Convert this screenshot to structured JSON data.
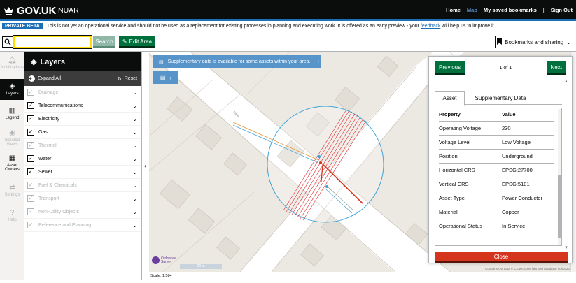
{
  "header": {
    "logo_text": "GOV.UK",
    "service_name": "NUAR",
    "nav": {
      "home": "Home",
      "map": "Map",
      "saved": "My saved bookmarks",
      "separator": "|",
      "signout": "Sign Out"
    }
  },
  "banner": {
    "tag": "PRIVATE BETA",
    "text_before": "This is not yet an operational service and should not be used as a replacement for existing processes in planning and executing work. It is offered as an early preview - your",
    "link": "feedback",
    "text_after": "will help us to improve it."
  },
  "toolbar": {
    "search_value": "",
    "search_button": "Search",
    "edit_area": "Edit Area",
    "bookmarks": "Bookmarks and sharing"
  },
  "rail": {
    "notifications": "Notifications",
    "layers": "Layers",
    "legend": "Legend",
    "isolated_views": "Isolated Views",
    "asset_owners": "Asset Owners",
    "settings": "Settings",
    "help": "Help"
  },
  "layers": {
    "title": "Layers",
    "expand_all": "Expand All",
    "reset": "Reset",
    "items": [
      {
        "label": "Drainage",
        "checked": true,
        "enabled": false
      },
      {
        "label": "Telecommunications",
        "checked": true,
        "enabled": true
      },
      {
        "label": "Electricity",
        "checked": true,
        "enabled": true
      },
      {
        "label": "Gas",
        "checked": true,
        "enabled": true
      },
      {
        "label": "Thermal",
        "checked": true,
        "enabled": false
      },
      {
        "label": "Water",
        "checked": true,
        "enabled": true
      },
      {
        "label": "Sewer",
        "checked": true,
        "enabled": true
      },
      {
        "label": "Fuel & Chemicals",
        "checked": true,
        "enabled": false
      },
      {
        "label": "Transport",
        "checked": true,
        "enabled": false
      },
      {
        "label": "Non-Utility Objects",
        "checked": true,
        "enabled": false
      },
      {
        "label": "Reference and Planning",
        "checked": true,
        "enabled": false
      }
    ]
  },
  "map": {
    "notice": "Supplementary data is available for some assets within your area.",
    "os_logo": "Ordnance Survey",
    "scale_bar": "20 m",
    "copyright": "Contains OS data © Crown copyright and database rights 2023",
    "scale": "Scale: 1:584"
  },
  "panel": {
    "previous": "Previous",
    "pager": "1 of 1",
    "next": "Next",
    "tab_asset": "Asset",
    "tab_supplementary": "Supplementary Data",
    "col_property": "Property",
    "col_value": "Value",
    "rows": [
      {
        "k": "Operating Voltage",
        "v": "230"
      },
      {
        "k": "Voltage Level",
        "v": "Low Voltage"
      },
      {
        "k": "Position",
        "v": "Underground"
      },
      {
        "k": "Horizontal CRS",
        "v": "EPSG:27700"
      },
      {
        "k": "Vertical CRS",
        "v": "EPSG:5101"
      },
      {
        "k": "Asset Type",
        "v": "Power Conductor"
      },
      {
        "k": "Material",
        "v": "Copper"
      },
      {
        "k": "Operational Status",
        "v": "In Service"
      }
    ],
    "close": "Close"
  },
  "colors": {
    "header": "#0b0c0c",
    "govuk_blue": "#1d70b8",
    "green_button": "#00703c",
    "close_red": "#d4351c",
    "buffer_circle": "#3fa3d6",
    "electric_red": "#d4351c"
  }
}
